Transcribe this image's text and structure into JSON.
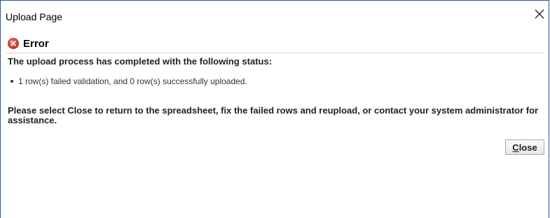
{
  "window": {
    "title": "Upload Page"
  },
  "dialog": {
    "error_title": "Error",
    "status_heading": "The upload process has completed with the following status:",
    "status_items": [
      "1 row(s) failed validation, and 0 row(s) successfully uploaded."
    ],
    "instructions": "Please select Close to return to the spreadsheet, fix the failed rows and reupload, or contact your system administrator for assistance.",
    "close_button": {
      "mnemonic": "C",
      "rest": "lose"
    }
  },
  "icons": {
    "window_close": "close-icon",
    "error": "error-icon"
  },
  "colors": {
    "error_red": "#d9342b",
    "window_border": "#2b5797"
  }
}
